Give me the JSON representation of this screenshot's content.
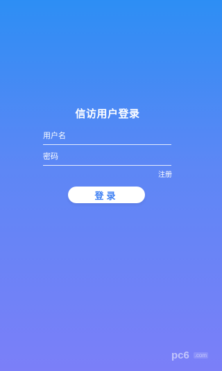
{
  "login": {
    "title": "信访用户登录",
    "username_placeholder": "用户名",
    "password_placeholder": "密码",
    "register_label": "注册",
    "login_label": "登录"
  },
  "watermark": {
    "brand": "pc6",
    "suffix": ".com"
  },
  "colors": {
    "gradient_top": "#2d8ef4",
    "gradient_bottom": "#7b7ff8",
    "button_text": "#3d7ff3",
    "button_bg": "#ffffff"
  }
}
